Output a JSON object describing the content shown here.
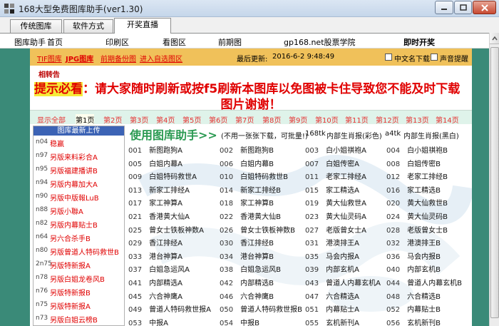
{
  "window": {
    "title": "168大型免费图库助手(ver1.30)"
  },
  "tabs": [
    {
      "label": "传统图库"
    },
    {
      "label": "软件方式"
    },
    {
      "label": "开奖直播"
    }
  ],
  "menubar": {
    "helper": "图库助手",
    "home": "首页",
    "print": "印刷区",
    "view": "看图区",
    "previous": "前期图",
    "site": "gp168.net股票学院",
    "live": "即时开奖"
  },
  "infobar": {
    "tif": "TIF图库",
    "jpg": "JPG图库",
    "backup": "前期备份图",
    "enter": "进入自选图区",
    "updated_label": "最后更新:",
    "updated_value": "2016-6-2 9:48:49",
    "opt_cn": "中文名下载",
    "opt_sound": "声音提醒"
  },
  "notice": {
    "small": "相转告",
    "highlight": "提示必看",
    "line1": "：请大家随时刷新或按f5刷新本图库以免图被卡住导致您不能及时下载",
    "line2": "图片谢谢！"
  },
  "pages": [
    "显示全部",
    "第1页",
    "第2页",
    "第3页",
    "第4页",
    "第5页",
    "第6页",
    "第7页",
    "第8页",
    "第9页",
    "第10页",
    "第11页",
    "第12页",
    "第13页",
    "第14页"
  ],
  "sidebar": {
    "header": "图库最新上传",
    "items": [
      {
        "code": "n04",
        "name": "稳赢"
      },
      {
        "code": "n97",
        "name": "另版来料彩合A"
      },
      {
        "code": "n95",
        "name": "另版福建播讲B"
      },
      {
        "code": "n94",
        "name": "另版内幕加大A"
      },
      {
        "code": "n90",
        "name": "另版中版報LuB"
      },
      {
        "code": "n88",
        "name": "另版小聯A"
      },
      {
        "code": "n82",
        "name": "另版内幕贴士B"
      },
      {
        "code": "n64",
        "name": "另六合杀手B"
      },
      {
        "code": "n80",
        "name": "另版曾道人特码救世B"
      },
      {
        "code": "2n75",
        "name": "另版特新报A"
      },
      {
        "code": "n78",
        "name": "另版白姐龙卷风B"
      },
      {
        "code": "n76",
        "name": "另版特新报B"
      },
      {
        "code": "n75",
        "name": "另版特新报A"
      },
      {
        "code": "n73",
        "name": "另版白姐云榜B"
      }
    ]
  },
  "main": {
    "title": "使用图库助手>>",
    "sub1": "(不用一张张下载，可批量!)",
    "sub2": "168tk",
    "sub3": "内部生肖报(彩色)",
    "sub4": "a4tk",
    "sub5": "内部生肖报(黑白)"
  },
  "grid": [
    [
      [
        "001",
        "新图跑狗A"
      ],
      [
        "002",
        "新图跑狗B"
      ],
      [
        "003",
        "白小姐祺袍A"
      ],
      [
        "004",
        "白小姐祺袍B"
      ]
    ],
    [
      [
        "005",
        "白姐内幕A"
      ],
      [
        "006",
        "白姐内幕B"
      ],
      [
        "007",
        "白姐传密A"
      ],
      [
        "008",
        "白姐传密B"
      ]
    ],
    [
      [
        "009",
        "白姐特码救世A"
      ],
      [
        "010",
        "白姐特码救世B"
      ],
      [
        "011",
        "老家工排经A"
      ],
      [
        "012",
        "老家工排经B"
      ]
    ],
    [
      [
        "013",
        "新家工排经A"
      ],
      [
        "014",
        "新家工排经B"
      ],
      [
        "015",
        "家工精选A"
      ],
      [
        "016",
        "家工精选B"
      ]
    ],
    [
      [
        "017",
        "家工神算A"
      ],
      [
        "018",
        "家工神算B"
      ],
      [
        "019",
        "黄大仙救世A"
      ],
      [
        "020",
        "黄大仙救世B"
      ]
    ],
    [
      [
        "021",
        "香港黄大仙A"
      ],
      [
        "022",
        "香港黄大仙B"
      ],
      [
        "023",
        "黄大仙灵码A"
      ],
      [
        "024",
        "黄大仙灵码B"
      ]
    ],
    [
      [
        "025",
        "曾女士铁板神数A"
      ],
      [
        "026",
        "曾女士铁板神数B"
      ],
      [
        "027",
        "老版曾女士A"
      ],
      [
        "028",
        "老版曾女士B"
      ]
    ],
    [
      [
        "029",
        "香江排经A"
      ],
      [
        "030",
        "香江排经B"
      ],
      [
        "031",
        "港澳排王A"
      ],
      [
        "032",
        "港澳排王B"
      ]
    ],
    [
      [
        "033",
        "港台神算A"
      ],
      [
        "034",
        "港台神算B"
      ],
      [
        "035",
        "马会内报A"
      ],
      [
        "036",
        "马会内报B"
      ]
    ],
    [
      [
        "037",
        "白姐急运风A"
      ],
      [
        "038",
        "白姐急运风B"
      ],
      [
        "039",
        "内部玄机A"
      ],
      [
        "040",
        "内部玄机B"
      ]
    ],
    [
      [
        "041",
        "内部精选A"
      ],
      [
        "042",
        "内部精选B"
      ],
      [
        "043",
        "曾道人内幕玄机A"
      ],
      [
        "044",
        "曾道人内幕玄机B"
      ]
    ],
    [
      [
        "045",
        "六合神鹰A"
      ],
      [
        "046",
        "六合神鹰B"
      ],
      [
        "047",
        "六合精选A"
      ],
      [
        "048",
        "六合精选B"
      ]
    ],
    [
      [
        "049",
        "曾道人特码救世报A"
      ],
      [
        "050",
        "曾道人特码救世报B"
      ],
      [
        "051",
        "内幕贴士A"
      ],
      [
        "052",
        "内幕贴士B"
      ]
    ],
    [
      [
        "053",
        "中报A"
      ],
      [
        "054",
        "中报B"
      ],
      [
        "055",
        "玄机新刊A"
      ],
      [
        "056",
        "玄机新刊B"
      ]
    ]
  ],
  "colors": {
    "frame": "#3a8a78",
    "infobar": "#f0c15a",
    "notice_red": "#e00000",
    "highlight": "#f6eb39",
    "title_green": "#2b9a52",
    "sidebar_header": "#3c63b5"
  }
}
